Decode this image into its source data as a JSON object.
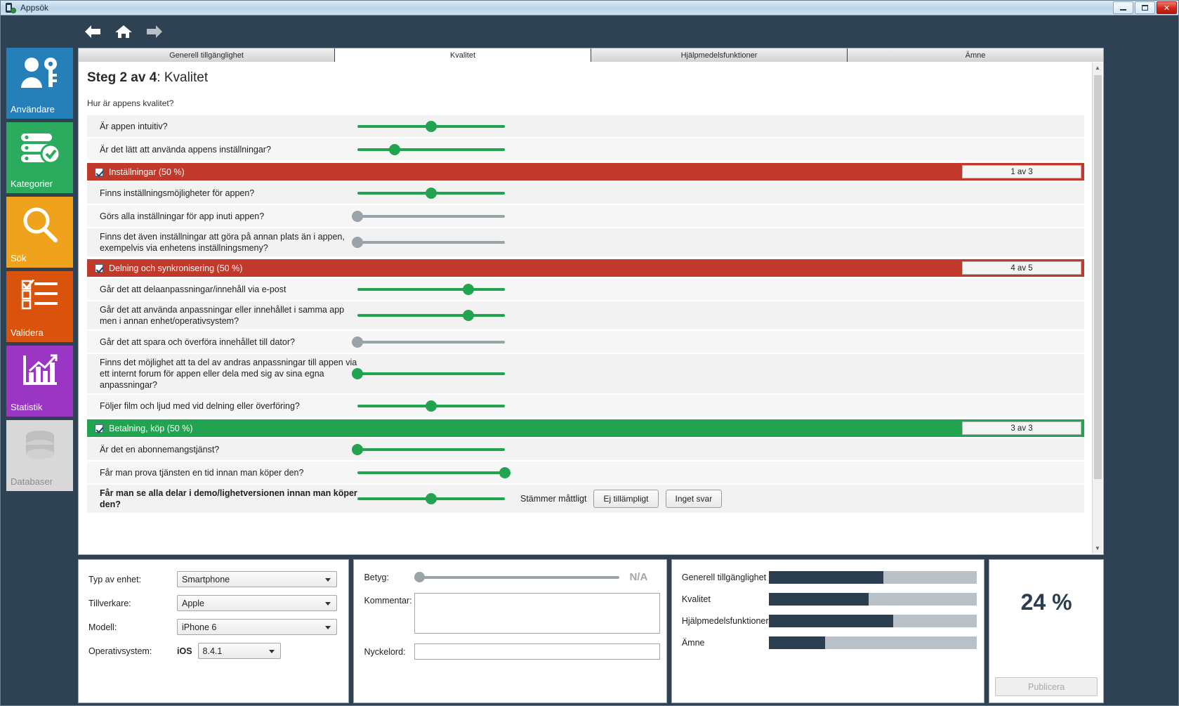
{
  "window": {
    "title": "Appsök",
    "icon": "phone-gear-icon",
    "minimize": "–",
    "maximize": "□",
    "close": "✕"
  },
  "nav": {
    "back": "back-arrow-icon",
    "home": "home-icon",
    "forward": "forward-arrow-icon"
  },
  "sidebar": {
    "items": [
      {
        "label": "Användare",
        "icon": "user-key-icon",
        "color": "#2580ba",
        "enabled": true
      },
      {
        "label": "Kategorier",
        "icon": "server-check-icon",
        "color": "#2bab5d",
        "enabled": true
      },
      {
        "label": "Sök",
        "icon": "magnifier-icon",
        "color": "#efa31d",
        "enabled": true
      },
      {
        "label": "Validera",
        "icon": "checklist-icon",
        "color": "#d9530c",
        "enabled": true
      },
      {
        "label": "Statistik",
        "icon": "bar-chart-icon",
        "color": "#9b35c4",
        "enabled": true
      },
      {
        "label": "Databaser",
        "icon": "database-icon",
        "color": "#d8d8d8",
        "enabled": false
      }
    ]
  },
  "tabs": [
    {
      "label": "Generell tillgänglighet",
      "active": false
    },
    {
      "label": "Kvalitet",
      "active": true
    },
    {
      "label": "Hjälpmedelsfunktioner",
      "active": false
    },
    {
      "label": "Ämne",
      "active": false
    }
  ],
  "page": {
    "heading_bold": "Steg 2 av 4",
    "heading_rest": ": Kvalitet",
    "subtitle": "Hur är appens kvalitet?"
  },
  "rows": [
    {
      "kind": "question",
      "text": "Är appen intuitiv?",
      "slider": {
        "color": "green",
        "value": 50
      }
    },
    {
      "kind": "question",
      "text": "Är det lätt att använda appens inställningar?",
      "slider": {
        "color": "green",
        "value": 25
      }
    },
    {
      "kind": "section",
      "title": "Inställningar (50 %)",
      "count": "1 av 3",
      "color": "red",
      "checked": true
    },
    {
      "kind": "question",
      "text": "Finns inställningsmöjligheter för appen?",
      "slider": {
        "color": "green",
        "value": 50
      }
    },
    {
      "kind": "question",
      "text": "Görs alla inställningar för app inuti appen?",
      "slider": {
        "color": "gray",
        "value": 0
      }
    },
    {
      "kind": "question",
      "text": "Finns det även inställningar att göra på annan plats än i appen, exempelvis via enhetens inställningsmeny?",
      "slider": {
        "color": "gray",
        "value": 0
      }
    },
    {
      "kind": "section",
      "title": "Delning och synkronisering (50 %)",
      "count": "4 av 5",
      "color": "red",
      "checked": true
    },
    {
      "kind": "question",
      "text": "Går det att delaanpassningar/innehåll via e-post",
      "slider": {
        "color": "green",
        "value": 75
      }
    },
    {
      "kind": "question",
      "text": "Går det att använda anpassningar eller innehållet i samma app men i annan enhet/operativsystem?",
      "slider": {
        "color": "green",
        "value": 75
      }
    },
    {
      "kind": "question",
      "text": "Går det att spara och överföra innehållet till dator?",
      "slider": {
        "color": "gray",
        "value": 0
      }
    },
    {
      "kind": "question",
      "text": "Finns det möjlighet att ta del av andras anpassningar till appen via ett internt forum för appen eller dela med sig av sina egna anpassningar?",
      "slider": {
        "color": "green",
        "value": 0
      }
    },
    {
      "kind": "question",
      "text": "Följer film och ljud med vid delning eller överföring?",
      "slider": {
        "color": "green",
        "value": 50
      }
    },
    {
      "kind": "section",
      "title": "Betalning, köp (50 %)",
      "count": "3 av 3",
      "color": "green",
      "checked": true
    },
    {
      "kind": "question",
      "text": "Är det en abonnemangstjänst?",
      "slider": {
        "color": "green",
        "value": 0
      }
    },
    {
      "kind": "question",
      "text": "Får man prova tjänsten en tid innan man köper den?",
      "slider": {
        "color": "green",
        "value": 100
      }
    },
    {
      "kind": "question",
      "text": "Får man se alla delar i demo/lighetversionen innan man köper den?",
      "bold": true,
      "slider": {
        "color": "green",
        "value": 50
      },
      "extra_label": "Stämmer måttligt",
      "buttons": [
        "Ej tillämpligt",
        "Inget svar"
      ]
    }
  ],
  "device_panel": {
    "fields": [
      {
        "label": "Typ av enhet:",
        "value": "Smartphone"
      },
      {
        "label": "Tillverkare:",
        "value": "Apple"
      },
      {
        "label": "Modell:",
        "value": "iPhone 6"
      }
    ],
    "os_label": "Operativsystem:",
    "os_name": "iOS",
    "os_version": "8.4.1"
  },
  "rating_panel": {
    "rating_label": "Betyg:",
    "rating_value": "N/A",
    "comment_label": "Kommentar:",
    "comment_value": "",
    "keyword_label": "Nyckelord:",
    "keyword_value": ""
  },
  "progress_panel": {
    "items": [
      {
        "label": "Generell tillgänglighet",
        "percent": 55
      },
      {
        "label": "Kvalitet",
        "percent": 48
      },
      {
        "label": "Hjälpmedelsfunktioner",
        "percent": 60
      },
      {
        "label": "Ämne",
        "percent": 27
      }
    ]
  },
  "total_panel": {
    "percent": "24 %",
    "publish_label": "Publicera"
  },
  "colors": {
    "accent_dark": "#2b3e50",
    "green": "#22a34f",
    "red": "#c0392b",
    "gray_slider": "#9aa3a8"
  }
}
